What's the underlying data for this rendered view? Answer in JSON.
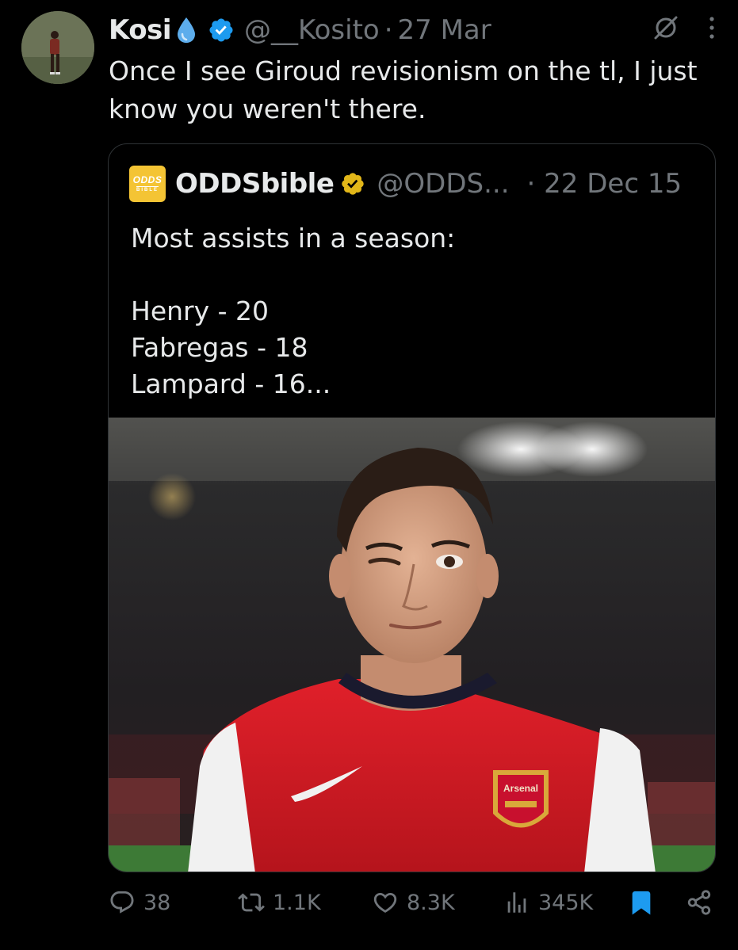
{
  "author": {
    "name": "Kosi",
    "handle": "@__Kosito",
    "separator": "·",
    "timestamp": "27 Mar"
  },
  "tweet": {
    "text": "Once I see Giroud revisionism on the tl, I just know you weren't there."
  },
  "quote": {
    "logo_line1": "ODDS",
    "logo_line2": "BIBLE",
    "name": "ODDSbible",
    "handle": "@ODDS...",
    "separator": "·",
    "timestamp": "22 Dec 15",
    "lines": [
      "Most assists in a season:",
      "",
      "Henry - 20",
      "Fabregas - 18",
      "Lampard - 16..."
    ],
    "image_crest_text": "Arsenal"
  },
  "actions": {
    "replies": "38",
    "reposts": "1.1K",
    "likes": "8.3K",
    "views": "345K"
  },
  "colors": {
    "background": "#000000",
    "text_primary": "#e7e9ea",
    "text_secondary": "#71767b",
    "verified_blue": "#1d9bf0",
    "verified_gold": "#e2b719",
    "bookmark_active": "#1d9bf0",
    "border": "#2f3336"
  },
  "icons": {
    "verified": "verified-badge-icon",
    "gold_verified": "gold-verified-badge-icon",
    "grok": "grok-icon",
    "more": "more-icon",
    "reply": "reply-icon",
    "repost": "repost-icon",
    "like": "heart-icon",
    "views": "views-icon",
    "bookmark": "bookmark-icon",
    "share": "share-icon"
  }
}
